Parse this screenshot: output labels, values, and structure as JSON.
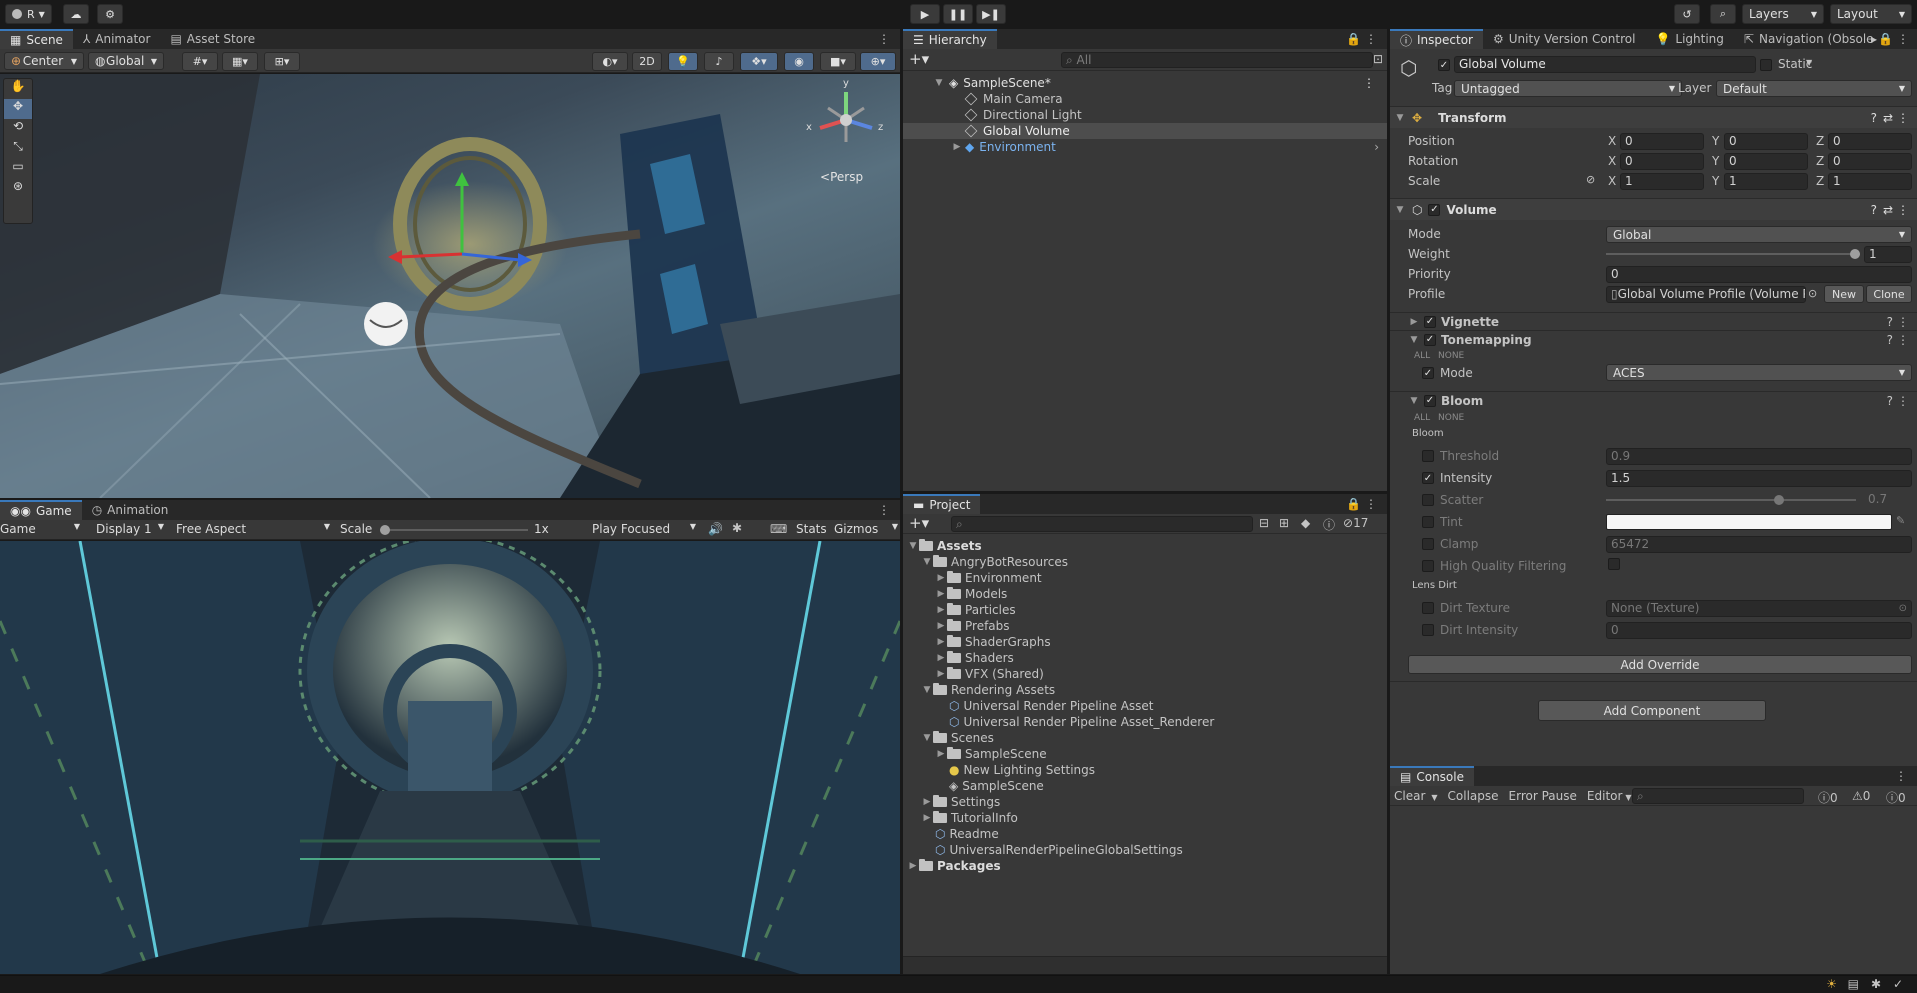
{
  "toolbar": {
    "account_initial": "R",
    "layers_label": "Layers",
    "layout_label": "Layout"
  },
  "scene_panel": {
    "tabs": [
      "Scene",
      "Animator",
      "Asset Store"
    ],
    "pivot_label": "Center",
    "space_label": "Global",
    "mode_2d_label": "2D",
    "persp_label": "Persp",
    "axes": {
      "x": "x",
      "y": "y",
      "z": "z"
    }
  },
  "game_panel": {
    "tabs": [
      "Game",
      "Animation"
    ],
    "game_label": "Game",
    "display_label": "Display 1",
    "aspect_label": "Free Aspect",
    "scale_label": "Scale",
    "scale_value": "1x",
    "scale_level": 0,
    "play_focused_label": "Play Focused",
    "stats_label": "Stats",
    "gizmos_label": "Gizmos"
  },
  "hierarchy": {
    "tab": "Hierarchy",
    "search_placeholder": "All",
    "scene_name": "SampleScene*",
    "items": [
      "Main Camera",
      "Directional Light",
      "Global Volume",
      "Environment"
    ]
  },
  "project": {
    "tab": "Project",
    "hidden_count": "17",
    "root": "Assets",
    "angrybot": "AngryBotResources",
    "angrybot_children": [
      "Environment",
      "Models",
      "Particles",
      "Prefabs",
      "ShaderGraphs",
      "Shaders",
      "VFX (Shared)"
    ],
    "rendering": "Rendering Assets",
    "rendering_children": [
      "Universal Render Pipeline Asset",
      "Universal Render Pipeline Asset_Renderer"
    ],
    "scenes": "Scenes",
    "scenes_children": [
      "SampleScene",
      "New Lighting Settings",
      "SampleScene"
    ],
    "settings": "Settings",
    "tutorial": "TutorialInfo",
    "readme": "Readme",
    "urp_global": "UniversalRenderPipelineGlobalSettings",
    "packages": "Packages"
  },
  "inspector": {
    "tabs": [
      "Inspector",
      "Unity Version Control",
      "Lighting",
      "Navigation (Obsole"
    ],
    "object_name": "Global Volume",
    "static_label": "Static",
    "tag_label": "Tag",
    "tag_value": "Untagged",
    "layer_label": "Layer",
    "layer_value": "Default",
    "transform": {
      "title": "Transform",
      "position_label": "Position",
      "rotation_label": "Rotation",
      "scale_label": "Scale",
      "axis_x": "X",
      "axis_y": "Y",
      "axis_z": "Z",
      "position": [
        "0",
        "0",
        "0"
      ],
      "rotation": [
        "0",
        "0",
        "0"
      ],
      "scale": [
        "1",
        "1",
        "1"
      ]
    },
    "volume": {
      "title": "Volume",
      "mode_label": "Mode",
      "mode_value": "Global",
      "weight_label": "Weight",
      "weight_value": "1",
      "weight_level": 1.0,
      "priority_label": "Priority",
      "priority_value": "0",
      "profile_label": "Profile",
      "profile_value": "Global Volume Profile (Volume P",
      "new_label": "New",
      "clone_label": "Clone"
    },
    "vignette": {
      "title": "Vignette"
    },
    "tonemapping": {
      "title": "Tonemapping",
      "all_label": "ALL",
      "none_label": "NONE",
      "mode_label": "Mode",
      "mode_value": "ACES"
    },
    "bloom": {
      "title": "Bloom",
      "all_label": "ALL",
      "none_label": "NONE",
      "section_label": "Bloom",
      "threshold_label": "Threshold",
      "threshold_value": "0.9",
      "intensity_label": "Intensity",
      "intensity_value": "1.5",
      "scatter_label": "Scatter",
      "scatter_value": "0.7",
      "scatter_level": 0.7,
      "tint_label": "Tint",
      "clamp_label": "Clamp",
      "clamp_value": "65472",
      "hq_label": "High Quality Filtering",
      "lens_dirt_label": "Lens Dirt",
      "dirt_texture_label": "Dirt Texture",
      "dirt_texture_value": "None (Texture)",
      "dirt_intensity_label": "Dirt Intensity",
      "dirt_intensity_value": "0"
    },
    "add_override_label": "Add Override",
    "add_component_label": "Add Component"
  },
  "console": {
    "tab": "Console",
    "clear_label": "Clear",
    "collapse_label": "Collapse",
    "error_pause_label": "Error Pause",
    "editor_label": "Editor",
    "log_count": "0",
    "warn_count": "0",
    "error_count": "0"
  },
  "colors": {
    "accent": "#3a79bb",
    "panel": "#383838",
    "selection": "#4d4d4d",
    "prefab_blue": "#7bb3ef"
  }
}
